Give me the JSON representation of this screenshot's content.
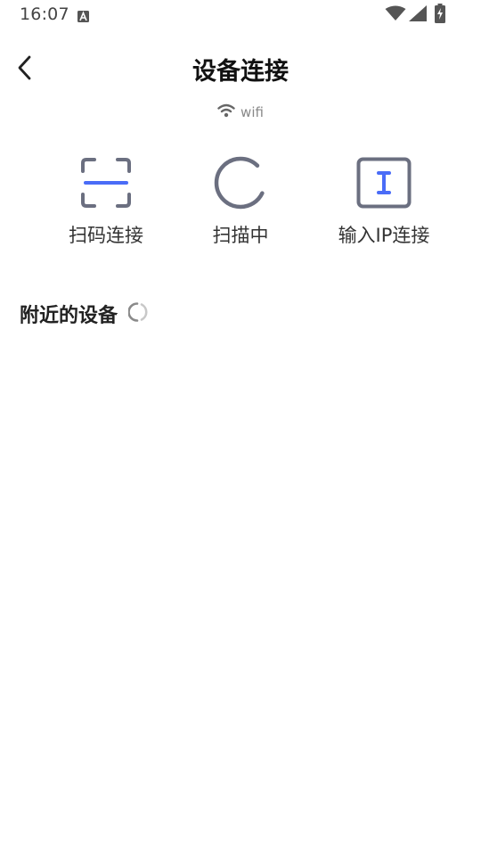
{
  "status_bar": {
    "time": "16:07",
    "icons": [
      "notification-a-icon",
      "wifi-signal-icon",
      "cell-signal-icon",
      "battery-charging-icon"
    ]
  },
  "header": {
    "back_icon": "chevron-left-icon",
    "title": "设备连接"
  },
  "network": {
    "icon": "wifi-icon",
    "name": "wifi"
  },
  "actions": [
    {
      "label": "扫码连接",
      "icon": "qr-scan-icon"
    },
    {
      "label": "扫描中",
      "icon": "loading-spinner-icon"
    },
    {
      "label": "输入IP连接",
      "icon": "text-input-icon"
    }
  ],
  "nearby": {
    "title": "附近的设备",
    "icon": "loading-spinner-icon"
  },
  "colors": {
    "accent": "#4a6cf7",
    "icon_gray": "#6b6f80",
    "text": "#333333"
  }
}
